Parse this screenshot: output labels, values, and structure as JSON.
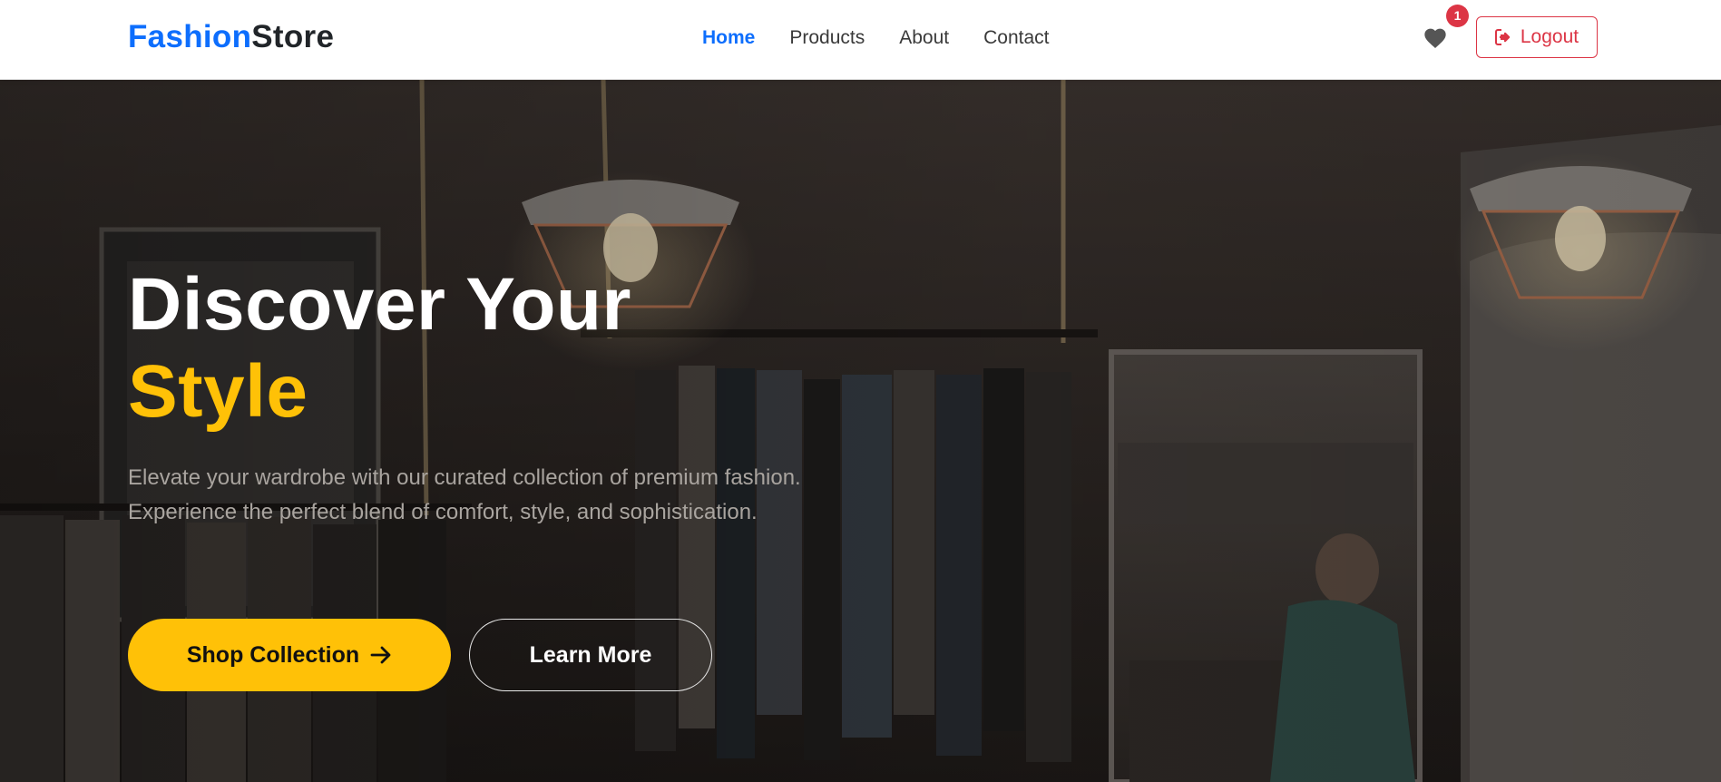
{
  "brand": {
    "part1": "Fashion",
    "part2": "Store"
  },
  "nav": {
    "items": [
      {
        "label": "Home",
        "active": true
      },
      {
        "label": "Products",
        "active": false
      },
      {
        "label": "About",
        "active": false
      },
      {
        "label": "Contact",
        "active": false
      }
    ]
  },
  "wishlist": {
    "icon": "heart-icon",
    "count": "1"
  },
  "logout": {
    "label": "Logout",
    "icon": "sign-out-icon"
  },
  "hero": {
    "title_line1": "Discover Your",
    "title_line2": "Style",
    "description": "Elevate your wardrobe with our curated collection of premium fashion. Experience the perfect blend of comfort, style, and sophistication.",
    "primary_button": "Shop Collection",
    "secondary_button": "Learn More"
  },
  "colors": {
    "brand_blue": "#0d6efd",
    "accent_yellow": "#ffc107",
    "danger_red": "#dc3545"
  }
}
